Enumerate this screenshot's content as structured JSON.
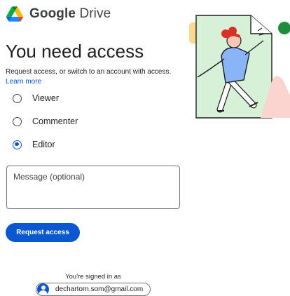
{
  "brand": {
    "name_bold": "Google",
    "name_rest": "Drive"
  },
  "page": {
    "title": "You need access",
    "subtitle": "Request access, or switch to an account with access.",
    "learn_more": "Learn more"
  },
  "roles": [
    {
      "label": "Viewer",
      "selected": false
    },
    {
      "label": "Commenter",
      "selected": false
    },
    {
      "label": "Editor",
      "selected": true
    }
  ],
  "message": {
    "placeholder": "Message (optional)"
  },
  "actions": {
    "request_label": "Request access"
  },
  "account": {
    "signed_in_label": "You're signed in as",
    "email": "dechartorn.som@gmail.com"
  },
  "colors": {
    "primary": "#0b57d0",
    "text": "#1f1f1f",
    "drive_green": "#1e8e3e",
    "drive_blue": "#4285f4",
    "drive_yellow": "#fbbc04"
  }
}
